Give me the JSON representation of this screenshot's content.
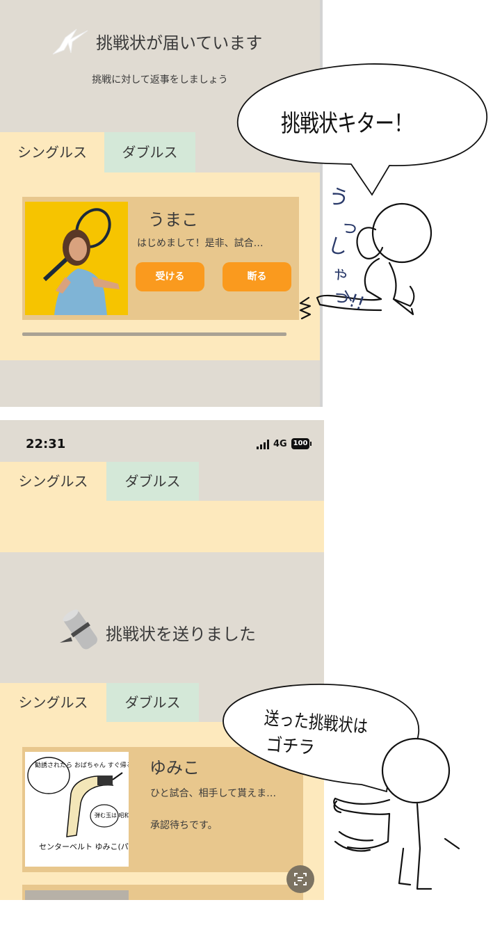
{
  "panel1": {
    "header": {
      "title": "挑戦状が届いています",
      "subtitle": "挑戦に対して返事をしましょう"
    },
    "tabs": {
      "singles": "シングルス",
      "doubles": "ダブルス"
    },
    "card": {
      "name": "うまこ",
      "message": "はじめまして！是非、試合…",
      "accept_label": "受ける",
      "decline_label": "断る"
    }
  },
  "bubble1": {
    "text": "挑戦状キター！"
  },
  "figure1_marks": {
    "text": "うっしゃーっ!!"
  },
  "panel2": {
    "status_bar": {
      "time": "22:31",
      "network": "4G",
      "battery": "100"
    },
    "tabs_top": {
      "singles": "シングルス",
      "doubles": "ダブルス"
    },
    "sent": {
      "title": "挑戦状を送りました",
      "tabs": {
        "singles": "シングルス",
        "doubles": "ダブルス"
      },
      "card": {
        "name": "ゆみこ",
        "message": "ひと試合、相手して貰えま…",
        "status": "承認待ちです。"
      }
    }
  },
  "bubble2": {
    "line1": "送った挑戦状は",
    "line2": "ゴチラ"
  },
  "drawing_text": {
    "note1": "勧誘されたら おばちゃん すぐ帰るぞ!!",
    "note2": "弾む玉は 昭和です！",
    "caption": "センターベルト ゆみこ(パート)"
  },
  "colors": {
    "accent": "#fa9a1e",
    "tab_singles": "#fde9bd",
    "tab_doubles": "#d4e8d8",
    "card": "#e8c78d",
    "panel_bg": "#e0dbd2"
  }
}
